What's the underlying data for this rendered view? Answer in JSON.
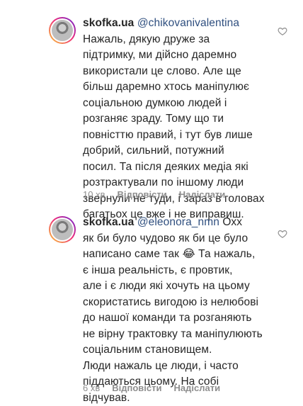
{
  "comments": [
    {
      "username": "skofka.ua",
      "mention": "@chikovanivalentina",
      "text": "Нажаль, дякую друже за\nпідтримку, ми дійсно даремно\nвикористали це слово. Але ще\nбільш даремно хтось маніпулює\nсоціальною думкою людей і\nрозганяє зраду. Тому що ти\nповністтю правий, і тут був лише\nдобрий, сильний, потужний\nпосил. Та після деяких медіа які\nрозтрактували по іншому люди\nзвернули не туди, і зараз в головах\nбагатьох це вже і не виправиш.",
      "time": "10 хв",
      "reply_label": "Відповісти",
      "send_label": "Надіслати"
    },
    {
      "username": "skofka.ua",
      "mention": "@eleonora_nmn",
      "first_line_rest": "Охх",
      "text": "як би було чудово як би це було\nнаписано саме так 😂 Та нажаль,\nє інша реальність, є провтик,\nале і є люди які хочуть на цьому\nскористатись вигодою із нелюбові\nдо нашої команди та розганяють\nне вірну трактовку та маніпулюють\nсоціальним становищем.\nЛюди нажаль це люди, і часто\nпіддаються цьому. На собі\nвідчував.",
      "time": "6 хв",
      "reply_label": "Відповісти",
      "send_label": "Надіслати"
    }
  ]
}
